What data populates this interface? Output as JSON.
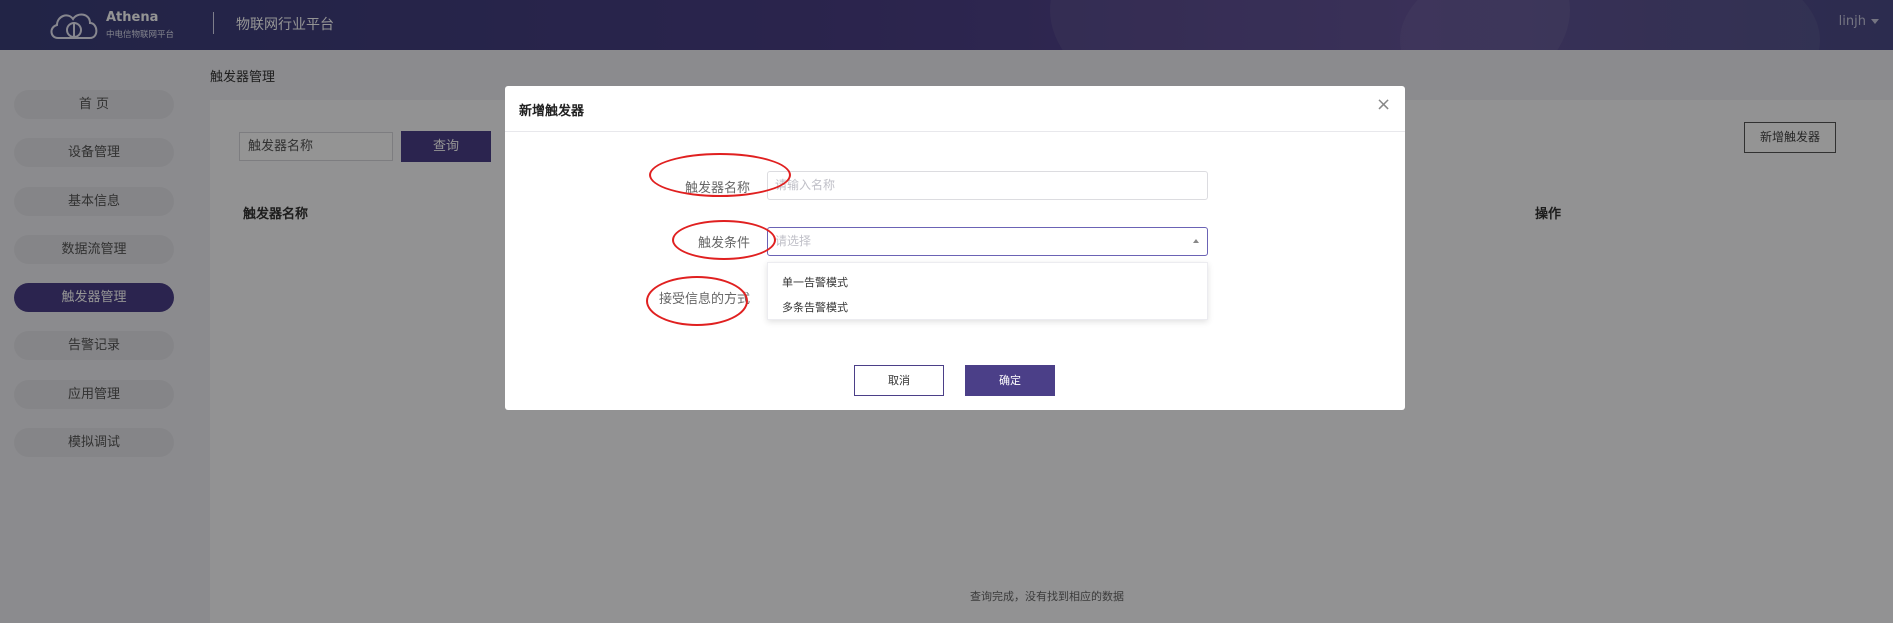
{
  "header": {
    "brand": "Athena",
    "brand_sub": "中电信物联网平台",
    "platform_title": "物联网行业平台",
    "user": "linjh"
  },
  "sidebar": {
    "items": [
      {
        "label": "首 页"
      },
      {
        "label": "设备管理"
      },
      {
        "label": "基本信息"
      },
      {
        "label": "数据流管理"
      },
      {
        "label": "触发器管理"
      },
      {
        "label": "告警记录"
      },
      {
        "label": "应用管理"
      },
      {
        "label": "模拟调试"
      }
    ],
    "active_index": 4
  },
  "main": {
    "breadcrumb": "触发器管理",
    "search_value": "触发器名称",
    "query_label": "查询",
    "add_label": "新增触发器",
    "table": {
      "columns": [
        "触发器名称",
        "操作"
      ]
    },
    "empty_message": "查询完成，没有找到相应的数据"
  },
  "modal": {
    "title": "新增触发器",
    "close_glyph": "×",
    "fields": {
      "name_label": "触发器名称",
      "name_placeholder": "请输入名称",
      "condition_label": "触发条件",
      "condition_placeholder": "请选择",
      "receive_label": "接受信息的方式"
    },
    "condition_options": [
      "单一告警模式",
      "多条告警模式"
    ],
    "cancel_label": "取消",
    "ok_label": "确定"
  },
  "colors": {
    "accent": "#4b3f88",
    "annotation": "#e02020"
  }
}
